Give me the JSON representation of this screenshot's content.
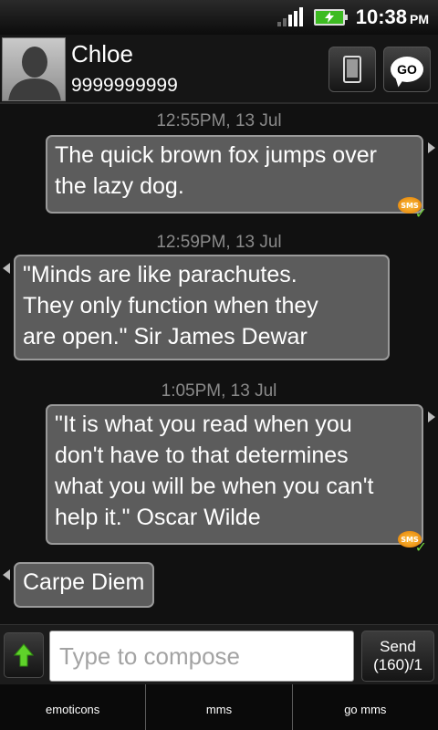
{
  "status_bar": {
    "time": "10:38",
    "ampm": "PM"
  },
  "contact": {
    "name": "Chloe",
    "number": "9999999999",
    "go_label": "GO"
  },
  "messages": [
    {
      "timestamp": "12:55PM, 13 Jul",
      "direction": "outgoing",
      "lines": [
        "The quick brown fox jumps over",
        "the lazy dog."
      ],
      "badge": "SMS"
    },
    {
      "timestamp": "12:59PM, 13 Jul",
      "direction": "incoming",
      "lines": [
        "\"Minds are like parachutes.",
        "They only function when they",
        "are open.\" Sir James Dewar"
      ]
    },
    {
      "timestamp": "1:05PM, 13 Jul",
      "direction": "outgoing",
      "lines": [
        "\"It is what you read when you",
        "don't have to that determines",
        "what you will be when you can't",
        "help it.\" Oscar Wilde"
      ],
      "badge": "SMS"
    },
    {
      "direction": "incoming",
      "lines": [
        "Carpe Diem"
      ]
    }
  ],
  "compose": {
    "placeholder": "Type to compose",
    "send_label": "Send",
    "counter": "(160)/1"
  },
  "toolbar": {
    "items": [
      "emoticons",
      "mms",
      "go mms"
    ]
  },
  "colors": {
    "bubble": "#5c5c5c",
    "battery": "#3dbb22",
    "badge": "#f59a0f",
    "check": "#6fd13b"
  }
}
